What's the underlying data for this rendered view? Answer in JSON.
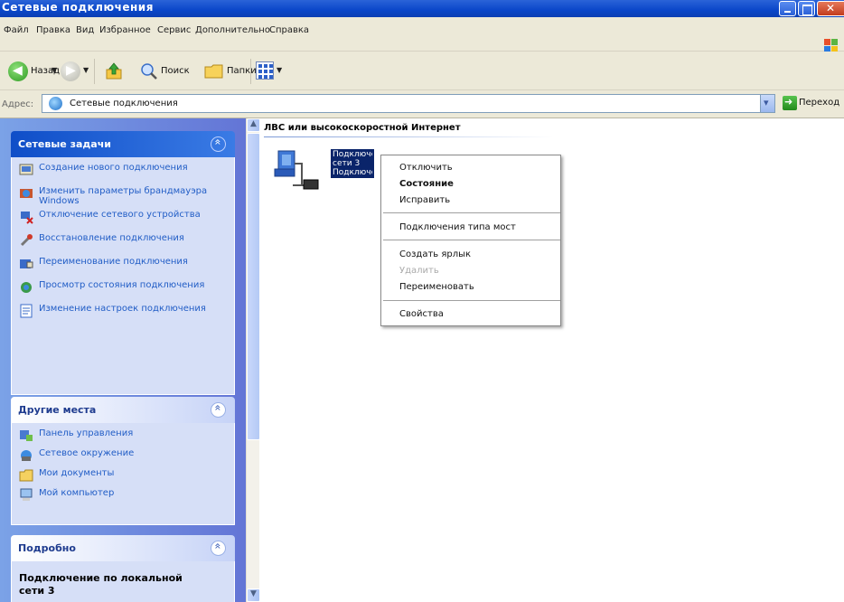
{
  "window": {
    "title": "Сетевые подключения"
  },
  "menu": {
    "items": [
      "Файл",
      "Правка",
      "Вид",
      "Избранное",
      "Сервис",
      "Дополнительно",
      "Справка"
    ]
  },
  "toolbar": {
    "back_label": "Назад",
    "search_label": "Поиск",
    "folders_label": "Папки"
  },
  "address": {
    "label": "Адрес:",
    "value": "Сетевые подключения",
    "go_label": "Переход"
  },
  "tasks_panel": {
    "title": "Сетевые задачи",
    "items": [
      {
        "label": "Создание нового подключения",
        "icon": "new-connection-icon"
      },
      {
        "label": "Изменить параметры брандмауэра Windows",
        "icon": "firewall-icon"
      },
      {
        "label": "Отключение сетевого устройства",
        "icon": "disable-device-icon"
      },
      {
        "label": "Восстановление подключения",
        "icon": "repair-icon"
      },
      {
        "label": "Переименование подключения",
        "icon": "rename-icon"
      },
      {
        "label": "Просмотр состояния подключения",
        "icon": "status-icon"
      },
      {
        "label": "Изменение настроек подключения",
        "icon": "settings-icon"
      }
    ]
  },
  "places_panel": {
    "title": "Другие места",
    "items": [
      {
        "label": "Панель управления",
        "icon": "control-panel-icon"
      },
      {
        "label": "Сетевое окружение",
        "icon": "network-places-icon"
      },
      {
        "label": "Мои документы",
        "icon": "my-documents-icon"
      },
      {
        "label": "Мой компьютер",
        "icon": "my-computer-icon"
      }
    ]
  },
  "details_panel": {
    "title": "Подробно",
    "name_line1": "Подключение по локальной",
    "name_line2": "сети 3"
  },
  "content": {
    "group_header": "ЛВС или высокоскоростной Интернет",
    "connection": {
      "line1": "Подключение",
      "line2": "сети 3",
      "line3": "Подключено"
    }
  },
  "context_menu": {
    "items": [
      {
        "label": "Отключить",
        "style": "normal"
      },
      {
        "label": "Состояние",
        "style": "bold"
      },
      {
        "label": "Исправить",
        "style": "normal"
      },
      {
        "label": "Подключения типа мост",
        "style": "normal"
      },
      {
        "label": "Создать ярлык",
        "style": "normal"
      },
      {
        "label": "Удалить",
        "style": "disabled"
      },
      {
        "label": "Переименовать",
        "style": "normal"
      },
      {
        "label": "Свойства",
        "style": "normal"
      }
    ]
  },
  "colors": {
    "titlebar": "#0a46c9",
    "selection": "#0a246a",
    "link": "#215dc6"
  }
}
